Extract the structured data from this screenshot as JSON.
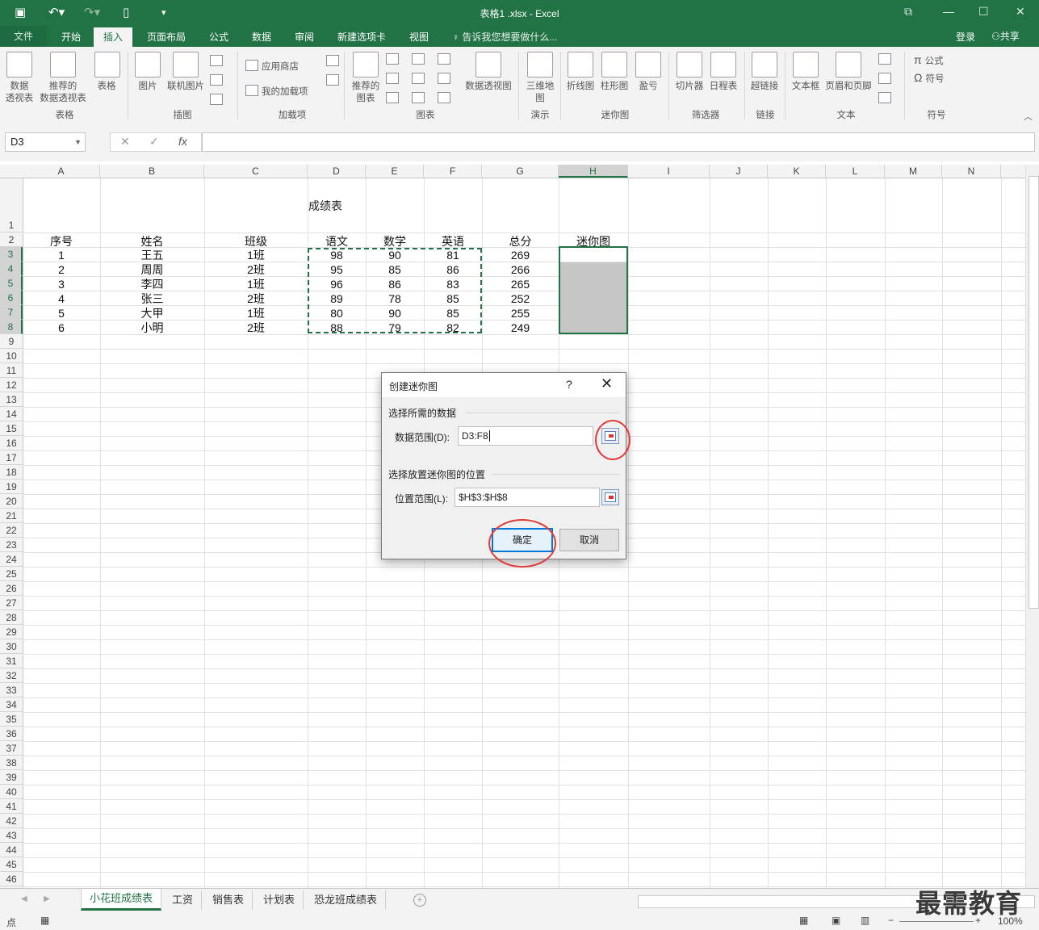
{
  "window": {
    "title": "表格1 .xlsx - Excel"
  },
  "ribbon_tabs": [
    "文件",
    "开始",
    "插入",
    "页面布局",
    "公式",
    "数据",
    "审阅",
    "新建选项卡",
    "视图"
  ],
  "active_tab": "插入",
  "tellme": "告诉我您想要做什么...",
  "account": {
    "login": "登录",
    "share": "共享"
  },
  "ribbon": {
    "table": [
      "数据\n透视表",
      "推荐的\n数据透视表",
      "表格"
    ],
    "illustrations": [
      "图片",
      "联机图片"
    ],
    "addins": [
      "应用商店",
      "我的加载项"
    ],
    "charts": [
      "推荐的\n图表",
      "数据透视图"
    ],
    "tours": [
      "三维地\n图"
    ],
    "sparklines": [
      "折线图",
      "柱形图",
      "盈亏"
    ],
    "filters": [
      "切片器",
      "日程表"
    ],
    "links": [
      "超链接"
    ],
    "text": [
      "文本框",
      "页眉和页脚"
    ],
    "symbols": [
      "公式",
      "符号"
    ],
    "groups": [
      "表格",
      "插图",
      "加载项",
      "图表",
      "演示",
      "迷你图",
      "筛选器",
      "链接",
      "文本",
      "符号"
    ]
  },
  "formula_bar": {
    "name_box": "D3",
    "fx": "fx",
    "value": ""
  },
  "columns": [
    "A",
    "B",
    "C",
    "D",
    "E",
    "F",
    "G",
    "H",
    "I",
    "J",
    "K",
    "L",
    "M",
    "N"
  ],
  "rows": [
    "1",
    "2",
    "3",
    "4",
    "5",
    "6",
    "7",
    "8",
    "9",
    "10",
    "11",
    "12",
    "13",
    "14",
    "15",
    "16",
    "17",
    "18",
    "19",
    "20",
    "21",
    "22",
    "23",
    "24",
    "25",
    "26",
    "27",
    "28",
    "29",
    "30",
    "31",
    "32",
    "33",
    "34",
    "35",
    "36",
    "37",
    "38",
    "39",
    "40",
    "41",
    "42",
    "43",
    "44",
    "45",
    "46"
  ],
  "sheet": {
    "title": "成绩表",
    "headers": [
      "序号",
      "姓名",
      "班级",
      "语文",
      "数学",
      "英语",
      "总分",
      "迷你图"
    ],
    "data": [
      [
        "1",
        "王五",
        "1班",
        "98",
        "90",
        "81",
        "269"
      ],
      [
        "2",
        "周周",
        "2班",
        "95",
        "85",
        "86",
        "266"
      ],
      [
        "3",
        "李四",
        "1班",
        "96",
        "86",
        "83",
        "265"
      ],
      [
        "4",
        "张三",
        "2班",
        "89",
        "78",
        "85",
        "252"
      ],
      [
        "5",
        "大甲",
        "1班",
        "80",
        "90",
        "85",
        "255"
      ],
      [
        "6",
        "小明",
        "2班",
        "88",
        "79",
        "82",
        "249"
      ]
    ]
  },
  "dialog": {
    "title": "创建迷你图",
    "help": "?",
    "close": "✕",
    "section1": "选择所需的数据",
    "data_range_label": "数据范围(D):",
    "data_range_value": "D3:F8",
    "section2": "选择放置迷你图的位置",
    "location_label": "位置范围(L):",
    "location_value": "$H$3:$H$8",
    "ok": "确定",
    "cancel": "取消"
  },
  "sheet_tabs": [
    "小花班成绩表",
    "工资",
    "销售表",
    "计划表",
    "恐龙班成绩表"
  ],
  "active_sheet": "小花班成绩表",
  "status": {
    "mode": "点",
    "zoom": "100%"
  },
  "watermark": "最需教育",
  "colors": {
    "excel_green": "#217346",
    "highlight_red": "#e23a3a"
  }
}
